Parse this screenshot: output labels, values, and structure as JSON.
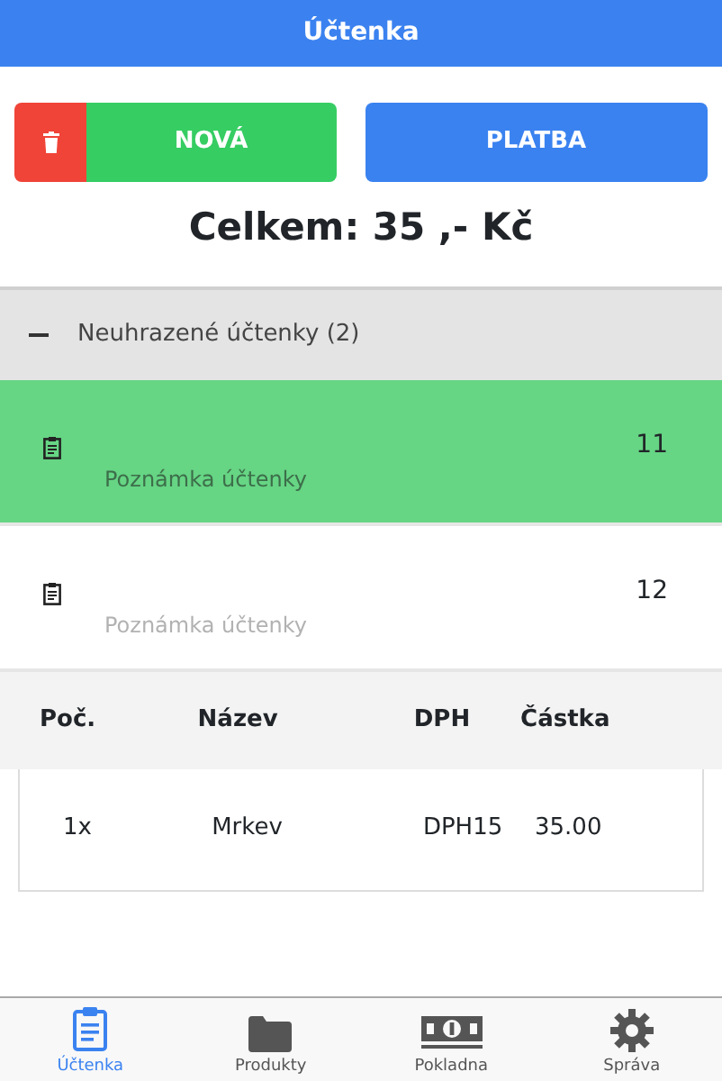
{
  "title": "Účtenka",
  "actions": [
    {
      "kind": "delete"
    },
    {
      "kind": "new",
      "label": "NOVÁ"
    },
    {
      "kind": "pay",
      "label": "PLATBA"
    }
  ],
  "total": "Celkem: 35 ,- Kč",
  "group": {
    "label": "Neuhrazené účtenky (2)",
    "expanded": true,
    "receipts": [
      {
        "note": "Poznámka účtenky",
        "number": "11",
        "selected": true
      },
      {
        "note": "Poznámka účtenky",
        "number": "12",
        "selected": false
      }
    ]
  },
  "table": {
    "columns": [
      "Poč.",
      "Název",
      "DPH",
      "Částka"
    ],
    "rows": [
      [
        "1x",
        "Mrkev",
        "DPH15",
        "35.00"
      ]
    ]
  },
  "tabs": [
    {
      "label": "Účtenka",
      "kind": "receipt",
      "selected": true
    },
    {
      "label": "Produkty",
      "kind": "folder",
      "selected": false
    },
    {
      "label": "Pokladna",
      "kind": "cash",
      "selected": false
    },
    {
      "label": "Správa",
      "kind": "gear",
      "selected": false
    }
  ]
}
